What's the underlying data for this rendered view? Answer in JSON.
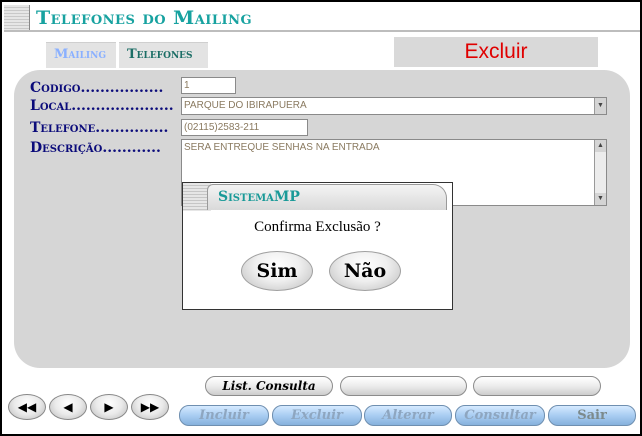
{
  "window": {
    "title": "Telefones do Mailing"
  },
  "tabs": [
    {
      "label": "Mailing"
    },
    {
      "label": "Telefones"
    }
  ],
  "mode_banner": "Excluir",
  "form": {
    "codigo": {
      "label": "Codigo.................",
      "value": "1"
    },
    "local": {
      "label": "Local.....................",
      "value": "PARQUE DO IBIRAPUERA"
    },
    "telefone": {
      "label": "Telefone...............",
      "value": "(02115)2583-211"
    },
    "descricao": {
      "label": "Descrição............",
      "value": "SERA ENTREQUE SENHAS NA ENTRADA"
    }
  },
  "dialog": {
    "title": "SistemaMP",
    "message": "Confirma Exclusão ?",
    "yes_label": "Sim",
    "no_label": "Não"
  },
  "navigation": {
    "first_icon": "first-record-icon",
    "prev_icon": "prev-record-icon",
    "next_icon": "next-record-icon",
    "last_icon": "last-record-icon"
  },
  "toolbar": {
    "list_consulta": "List. Consulta",
    "blank1": "",
    "blank2": "",
    "incluir": "Incluir",
    "excluir": "Excluir",
    "alterar": "Alterar",
    "consultar": "Consultar",
    "sair": "Sair"
  },
  "colors": {
    "title": "#17a2a0",
    "label": "#0b0b7a",
    "excluir_banner": "#e00000",
    "panel": "#d6d6d6"
  }
}
